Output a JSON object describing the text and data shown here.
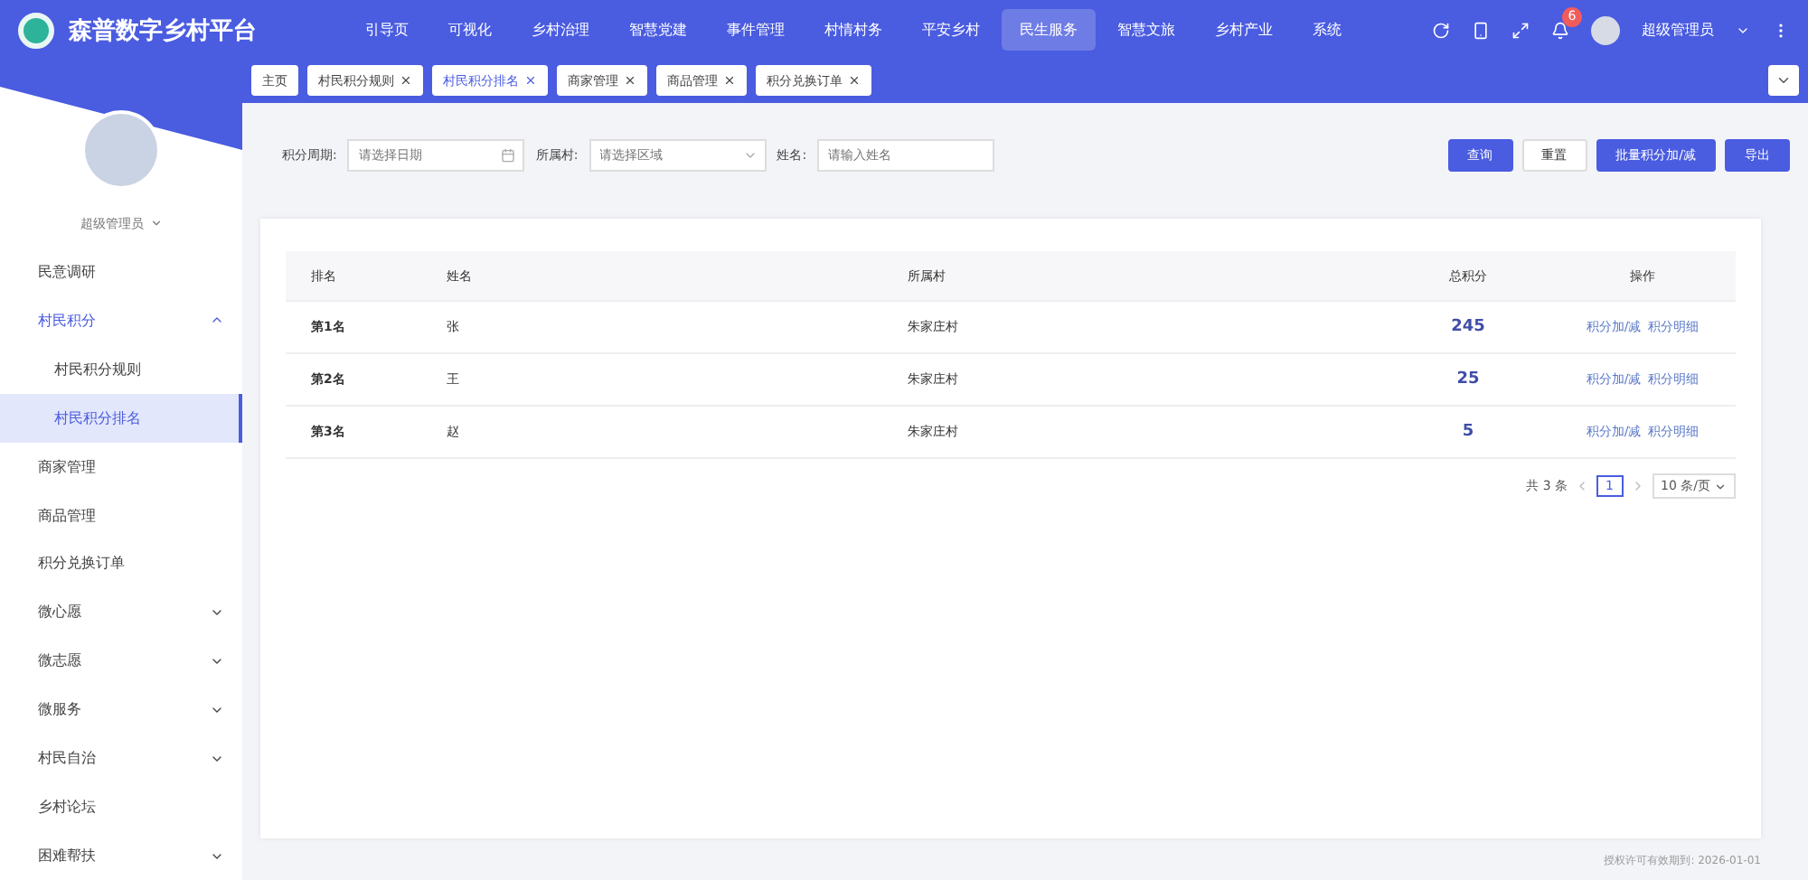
{
  "app": {
    "title": "森普数字乡村平台"
  },
  "nav": [
    {
      "label": "引导页",
      "selected": false
    },
    {
      "label": "可视化",
      "selected": false
    },
    {
      "label": "乡村治理",
      "selected": false
    },
    {
      "label": "智慧党建",
      "selected": false
    },
    {
      "label": "事件管理",
      "selected": false
    },
    {
      "label": "村情村务",
      "selected": false
    },
    {
      "label": "平安乡村",
      "selected": false
    },
    {
      "label": "民生服务",
      "selected": true
    },
    {
      "label": "智慧文旅",
      "selected": false
    },
    {
      "label": "乡村产业",
      "selected": false
    },
    {
      "label": "系统",
      "selected": false
    }
  ],
  "header": {
    "notification_count": "6",
    "user": "超级管理员"
  },
  "tabs": [
    {
      "label": "主页",
      "closable": false,
      "selected": false
    },
    {
      "label": "村民积分规则",
      "closable": true,
      "selected": false
    },
    {
      "label": "村民积分排名",
      "closable": true,
      "selected": true
    },
    {
      "label": "商家管理",
      "closable": true,
      "selected": false
    },
    {
      "label": "商品管理",
      "closable": true,
      "selected": false
    },
    {
      "label": "积分兑换订单",
      "closable": true,
      "selected": false
    }
  ],
  "sidebar": {
    "user": "超级管理员",
    "items": [
      {
        "label": "民意调研",
        "selected": false
      },
      {
        "label": "村民积分",
        "selected": false,
        "expanded": true,
        "children": [
          {
            "label": "村民积分规则",
            "selected": false
          },
          {
            "label": "村民积分排名",
            "selected": true
          }
        ]
      },
      {
        "label": "商家管理",
        "selected": false
      },
      {
        "label": "商品管理",
        "selected": false
      },
      {
        "label": "积分兑换订单",
        "selected": false
      },
      {
        "label": "微心愿",
        "selected": false,
        "expanded": false
      },
      {
        "label": "微志愿",
        "selected": false,
        "expanded": false
      },
      {
        "label": "微服务",
        "selected": false,
        "expanded": false
      },
      {
        "label": "村民自治",
        "selected": false,
        "expanded": false
      },
      {
        "label": "乡村论坛",
        "selected": false
      },
      {
        "label": "困难帮扶",
        "selected": false,
        "expanded": false
      }
    ]
  },
  "filters": [
    {
      "label": "积分周期:",
      "placeholder": "请选择日期",
      "kind": "date"
    },
    {
      "label": "所属村:",
      "placeholder": "请选择区域",
      "kind": "select"
    },
    {
      "label": "姓名:",
      "placeholder": "请输入姓名",
      "kind": "text"
    }
  ],
  "buttons": [
    {
      "label": "查询",
      "kind": "primary"
    },
    {
      "label": "重置",
      "kind": "plain"
    },
    {
      "label": "批量积分加/减",
      "kind": "primary"
    },
    {
      "label": "导出",
      "kind": "primary"
    }
  ],
  "table": {
    "columns": [
      "排名",
      "姓名",
      "所属村",
      "总积分",
      "操作"
    ],
    "rows": [
      {
        "rank": "第1名",
        "name": "张",
        "village": "朱家庄村",
        "points": "245",
        "actions": [
          "积分加/减",
          "积分明细"
        ]
      },
      {
        "rank": "第2名",
        "name": "王",
        "village": "朱家庄村",
        "points": "25",
        "actions": [
          "积分加/减",
          "积分明细"
        ]
      },
      {
        "rank": "第3名",
        "name": "赵",
        "village": "朱家庄村",
        "points": "5",
        "actions": [
          "积分加/减",
          "积分明细"
        ]
      }
    ]
  },
  "pagination": {
    "total": "共 3 条",
    "page": "1",
    "page_size": "10 条/页"
  },
  "footer": "授权许可有效期到: 2026-01-01"
}
